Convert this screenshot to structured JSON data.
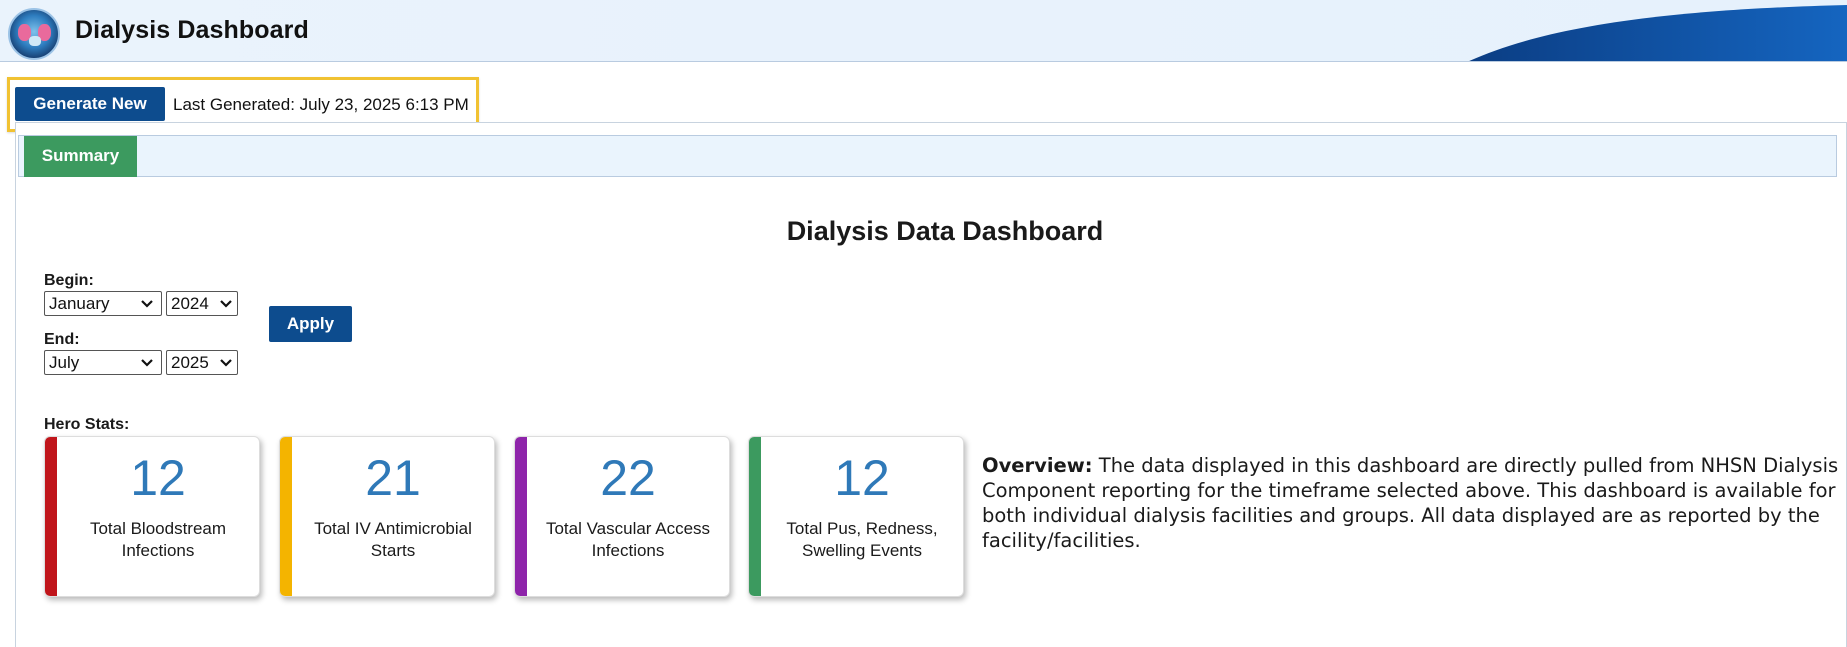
{
  "header": {
    "title": "Dialysis Dashboard",
    "logo_icon": "dialysis-logo-icon"
  },
  "generate": {
    "button_label": "Generate New",
    "last_generated": "Last Generated: July 23, 2025 6:13 PM"
  },
  "tabs": [
    {
      "label": "Summary",
      "active": true,
      "color": "#3c9a5f"
    }
  ],
  "dashboard": {
    "title": "Dialysis Data Dashboard",
    "begin_label": "Begin:",
    "begin_month": "January",
    "begin_year": "2024",
    "end_label": "End:",
    "end_month": "July",
    "end_year": "2025",
    "apply_label": "Apply",
    "hero_label": "Hero Stats:"
  },
  "hero_stats": [
    {
      "value": "12",
      "caption_line1": "Total Bloodstream",
      "caption_line2": "Infections",
      "color": "#c0151b"
    },
    {
      "value": "21",
      "caption_line1": "Total IV Antimicrobial",
      "caption_line2": "Starts",
      "color": "#f4b400"
    },
    {
      "value": "22",
      "caption_line1": "Total Vascular Access",
      "caption_line2": "Infections",
      "color": "#8e24aa"
    },
    {
      "value": "12",
      "caption_line1": "Total Pus, Redness,",
      "caption_line2": "Swelling Events",
      "color": "#3c9a5f"
    }
  ],
  "overview": {
    "heading": "Overview:",
    "text": "The data displayed in this dashboard are directly pulled from NHSN Dialysis Component reporting for the timeframe selected above. This dashboard is available for both individual dialysis facilities and groups. All data displayed are as reported by the facility/facilities."
  },
  "colors": {
    "primary_button": "#0d4c8e",
    "highlight_border": "#f1c232",
    "stat_number": "#2f79b8"
  }
}
